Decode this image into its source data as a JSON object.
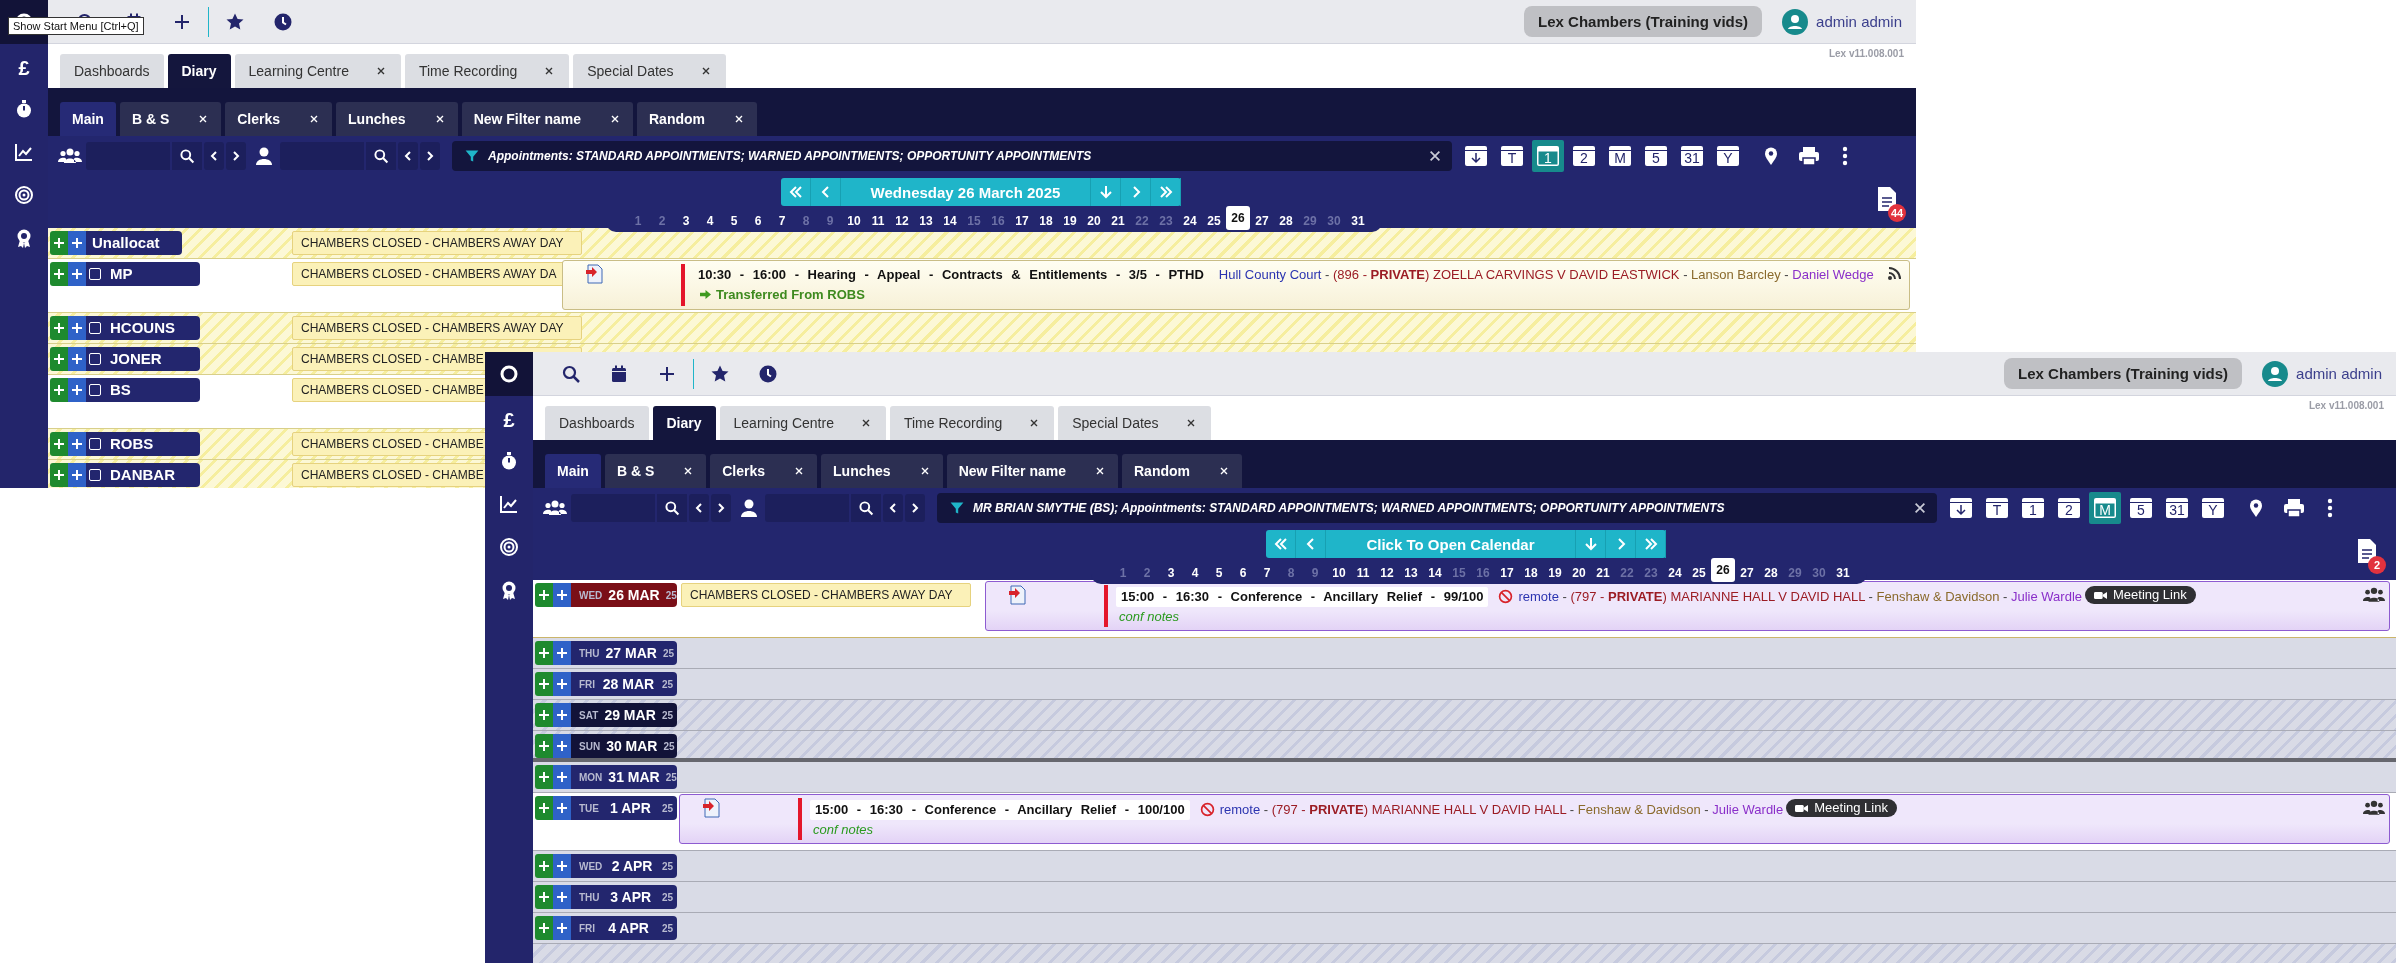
{
  "windows": [
    {
      "kind": "back",
      "tooltip": "Show Start Menu [Ctrl+Q]",
      "sidebar_currency": "£",
      "org_button": "Lex Chambers (Training vids)",
      "user": "admin admin",
      "version": "Lex v11.008.001",
      "tabs": [
        {
          "label": "Dashboards",
          "selected": false,
          "closable": false
        },
        {
          "label": "Diary",
          "selected": true,
          "closable": false
        },
        {
          "label": "Learning Centre",
          "selected": false,
          "closable": true
        },
        {
          "label": "Time Recording",
          "selected": false,
          "closable": true
        },
        {
          "label": "Special Dates",
          "selected": false,
          "closable": true
        }
      ],
      "filter_tabs": [
        {
          "label": "Main",
          "selected": true,
          "closable": false
        },
        {
          "label": "B & S",
          "selected": false,
          "closable": true
        },
        {
          "label": "Clerks",
          "selected": false,
          "closable": true
        },
        {
          "label": "Lunches",
          "selected": false,
          "closable": true
        },
        {
          "label": "New Filter name",
          "selected": false,
          "closable": true
        },
        {
          "label": "Random",
          "selected": false,
          "closable": true
        }
      ],
      "filter_text": "Appointments: STANDARD APPOINTMENTS; WARNED APPOINTMENTS; OPPORTUNITY APPOINTMENTS",
      "view_buttons": [
        {
          "kind": "arrow",
          "selected": false
        },
        {
          "kind": "letter",
          "label": "T",
          "selected": false
        },
        {
          "kind": "letter",
          "label": "1",
          "selected": true
        },
        {
          "kind": "letter",
          "label": "2",
          "selected": false
        },
        {
          "kind": "letter",
          "label": "M",
          "selected": false
        },
        {
          "kind": "letter",
          "label": "5",
          "selected": false
        },
        {
          "kind": "letter",
          "label": "31",
          "selected": false
        },
        {
          "kind": "letter",
          "label": "Y",
          "selected": false
        }
      ],
      "calendar_label": "Wednesday 26 March 2025",
      "document_badge": "44",
      "days": [
        {
          "label": "1",
          "weekend": true,
          "selected": false
        },
        {
          "label": "2",
          "weekend": true,
          "selected": false
        },
        {
          "label": "3",
          "weekend": false,
          "selected": false
        },
        {
          "label": "4",
          "weekend": false,
          "selected": false
        },
        {
          "label": "5",
          "weekend": false,
          "selected": false
        },
        {
          "label": "6",
          "weekend": false,
          "selected": false
        },
        {
          "label": "7",
          "weekend": false,
          "selected": false
        },
        {
          "label": "8",
          "weekend": true,
          "selected": false
        },
        {
          "label": "9",
          "weekend": true,
          "selected": false
        },
        {
          "label": "10",
          "weekend": false,
          "selected": false
        },
        {
          "label": "11",
          "weekend": false,
          "selected": false
        },
        {
          "label": "12",
          "weekend": false,
          "selected": false
        },
        {
          "label": "13",
          "weekend": false,
          "selected": false
        },
        {
          "label": "14",
          "weekend": false,
          "selected": false
        },
        {
          "label": "15",
          "weekend": true,
          "selected": false
        },
        {
          "label": "16",
          "weekend": true,
          "selected": false
        },
        {
          "label": "17",
          "weekend": false,
          "selected": false
        },
        {
          "label": "18",
          "weekend": false,
          "selected": false
        },
        {
          "label": "19",
          "weekend": false,
          "selected": false
        },
        {
          "label": "20",
          "weekend": false,
          "selected": false
        },
        {
          "label": "21",
          "weekend": false,
          "selected": false
        },
        {
          "label": "22",
          "weekend": true,
          "selected": false
        },
        {
          "label": "23",
          "weekend": true,
          "selected": false
        },
        {
          "label": "24",
          "weekend": false,
          "selected": false
        },
        {
          "label": "25",
          "weekend": false,
          "selected": false
        },
        {
          "label": "26",
          "weekend": false,
          "selected": true
        },
        {
          "label": "27",
          "weekend": false,
          "selected": false
        },
        {
          "label": "28",
          "weekend": false,
          "selected": false
        },
        {
          "label": "29",
          "weekend": true,
          "selected": false
        },
        {
          "label": "30",
          "weekend": true,
          "selected": false
        },
        {
          "label": "31",
          "weekend": false,
          "selected": false
        }
      ],
      "rows": [
        {
          "kind": "staff",
          "name": "Unallocat",
          "hatched": true,
          "note": "CHAMBERS CLOSED - CHAMBERS AWAY DAY"
        },
        {
          "kind": "staff",
          "name": "MP",
          "checked": false,
          "hatched": false,
          "note": "CHAMBERS CLOSED - CHAMBERS AWAY DA",
          "appointment": {
            "kind": "hearing",
            "restricted": false,
            "time_text": "10:30 - 16:00 - Hearing - Appeal - Contracts & Entitlements - 3/5 - PTHD",
            "details": [
              {
                "kind": "location",
                "text": "Hull County Court"
              },
              {
                "kind": "sep",
                "text": " - "
              },
              {
                "kind": "case",
                "text": "(896 - **PRIVATE**) ZOELLA CARVINGS V DAVID EASTWICK"
              },
              {
                "kind": "sep",
                "text": " - "
              },
              {
                "kind": "solicitor",
                "text": "Lanson Barcley"
              },
              {
                "kind": "sep",
                "text": " - "
              },
              {
                "kind": "clerk",
                "text": "Daniel Wedge"
              }
            ],
            "transfer_note": "Transferred From ROBS",
            "indicator": {
              "kind": "rss"
            }
          }
        },
        {
          "kind": "staff",
          "name": "HCOUNS",
          "checked": false,
          "hatched": true,
          "note": "CHAMBERS CLOSED - CHAMBERS AWAY DAY"
        },
        {
          "kind": "staff",
          "name": "JONER",
          "checked": false,
          "hatched": true,
          "note": "CHAMBERS CLOSED - CHAMBE"
        },
        {
          "kind": "staff",
          "name": "BS",
          "checked": false,
          "hatched": false,
          "note": "CHAMBERS CLOSED - CHAMBE"
        },
        {
          "kind": "staff",
          "name": "ROBS",
          "checked": false,
          "hatched": true,
          "note": "CHAMBERS CLOSED - CHAMBE"
        },
        {
          "kind": "staff",
          "name": "DANBAR",
          "checked": false,
          "hatched": true,
          "note": "CHAMBERS CLOSED - CHAMBE"
        }
      ]
    },
    {
      "kind": "front",
      "sidebar_currency": "£",
      "org_button": "Lex Chambers (Training vids)",
      "user": "admin admin",
      "version": "Lex v11.008.001",
      "tabs": [
        {
          "label": "Dashboards",
          "selected": false,
          "closable": false
        },
        {
          "label": "Diary",
          "selected": true,
          "closable": false
        },
        {
          "label": "Learning Centre",
          "selected": false,
          "closable": true
        },
        {
          "label": "Time Recording",
          "selected": false,
          "closable": true
        },
        {
          "label": "Special Dates",
          "selected": false,
          "closable": true
        }
      ],
      "filter_tabs": [
        {
          "label": "Main",
          "selected": true,
          "closable": false
        },
        {
          "label": "B & S",
          "selected": false,
          "closable": true
        },
        {
          "label": "Clerks",
          "selected": false,
          "closable": true
        },
        {
          "label": "Lunches",
          "selected": false,
          "closable": true
        },
        {
          "label": "New Filter name",
          "selected": false,
          "closable": true
        },
        {
          "label": "Random",
          "selected": false,
          "closable": true
        }
      ],
      "filter_text": "MR BRIAN SMYTHE (BS); Appointments: STANDARD APPOINTMENTS; WARNED APPOINTMENTS; OPPORTUNITY APPOINTMENTS",
      "view_buttons": [
        {
          "kind": "arrow",
          "selected": false
        },
        {
          "kind": "letter",
          "label": "T",
          "selected": false
        },
        {
          "kind": "letter",
          "label": "1",
          "selected": false
        },
        {
          "kind": "letter",
          "label": "2",
          "selected": false
        },
        {
          "kind": "letter",
          "label": "M",
          "selected": true
        },
        {
          "kind": "letter",
          "label": "5",
          "selected": false
        },
        {
          "kind": "letter",
          "label": "31",
          "selected": false
        },
        {
          "kind": "letter",
          "label": "Y",
          "selected": false
        }
      ],
      "calendar_label": "Click To Open Calendar",
      "document_badge": "2",
      "days": [
        {
          "label": "1",
          "weekend": true,
          "selected": false
        },
        {
          "label": "2",
          "weekend": true,
          "selected": false
        },
        {
          "label": "3",
          "weekend": false,
          "selected": false
        },
        {
          "label": "4",
          "weekend": false,
          "selected": false
        },
        {
          "label": "5",
          "weekend": false,
          "selected": false
        },
        {
          "label": "6",
          "weekend": false,
          "selected": false
        },
        {
          "label": "7",
          "weekend": false,
          "selected": false
        },
        {
          "label": "8",
          "weekend": true,
          "selected": false
        },
        {
          "label": "9",
          "weekend": true,
          "selected": false
        },
        {
          "label": "10",
          "weekend": false,
          "selected": false
        },
        {
          "label": "11",
          "weekend": false,
          "selected": false
        },
        {
          "label": "12",
          "weekend": false,
          "selected": false
        },
        {
          "label": "13",
          "weekend": false,
          "selected": false
        },
        {
          "label": "14",
          "weekend": false,
          "selected": false
        },
        {
          "label": "15",
          "weekend": true,
          "selected": false
        },
        {
          "label": "16",
          "weekend": true,
          "selected": false
        },
        {
          "label": "17",
          "weekend": false,
          "selected": false
        },
        {
          "label": "18",
          "weekend": false,
          "selected": false
        },
        {
          "label": "19",
          "weekend": false,
          "selected": false
        },
        {
          "label": "20",
          "weekend": false,
          "selected": false
        },
        {
          "label": "21",
          "weekend": false,
          "selected": false
        },
        {
          "label": "22",
          "weekend": true,
          "selected": false
        },
        {
          "label": "23",
          "weekend": true,
          "selected": false
        },
        {
          "label": "24",
          "weekend": false,
          "selected": false
        },
        {
          "label": "25",
          "weekend": false,
          "selected": false
        },
        {
          "label": "26",
          "weekend": false,
          "selected": true
        },
        {
          "label": "27",
          "weekend": false,
          "selected": false
        },
        {
          "label": "28",
          "weekend": false,
          "selected": false
        },
        {
          "label": "29",
          "weekend": true,
          "selected": false
        },
        {
          "label": "30",
          "weekend": true,
          "selected": false
        },
        {
          "label": "31",
          "weekend": false,
          "selected": false
        }
      ],
      "rows": [
        {
          "kind": "date",
          "weekday": "WED",
          "date": "26 MAR",
          "year": "25",
          "today": true,
          "hatched": false,
          "week_break_after": false,
          "note": "CHAMBERS CLOSED - CHAMBERS AWAY DAY",
          "appointment": {
            "kind": "conference",
            "restricted": true,
            "time_text": "15:00 - 16:30 - Conference - Ancillary Relief - 99/100",
            "details": [
              {
                "kind": "location",
                "text": "remote"
              },
              {
                "kind": "sep",
                "text": " - "
              },
              {
                "kind": "case",
                "text": "(797 - **PRIVATE**) MARIANNE HALL V DAVID HALL"
              },
              {
                "kind": "sep",
                "text": " - "
              },
              {
                "kind": "solicitor",
                "text": "Fenshaw & Davidson"
              },
              {
                "kind": "sep",
                "text": " - "
              },
              {
                "kind": "clerk",
                "text": "Julie Wardle"
              }
            ],
            "meeting_link": "Meeting Link",
            "notes": "conf notes",
            "indicator": {
              "kind": "group"
            }
          }
        },
        {
          "kind": "date",
          "weekday": "THU",
          "date": "27 MAR",
          "year": "25",
          "today": false,
          "hatched": false,
          "week_break_after": false
        },
        {
          "kind": "date",
          "weekday": "FRI",
          "date": "28 MAR",
          "year": "25",
          "today": false,
          "hatched": false,
          "week_break_after": false
        },
        {
          "kind": "date",
          "weekday": "SAT",
          "date": "29 MAR",
          "year": "25",
          "today": false,
          "hatched": true,
          "week_break_after": false
        },
        {
          "kind": "date",
          "weekday": "SUN",
          "date": "30 MAR",
          "year": "25",
          "today": false,
          "hatched": true,
          "week_break_after": true
        },
        {
          "kind": "date",
          "weekday": "MON",
          "date": "31 MAR",
          "year": "25",
          "today": false,
          "hatched": false,
          "week_break_after": false
        },
        {
          "kind": "date",
          "weekday": "TUE",
          "date": "1 APR",
          "year": "25",
          "today": false,
          "hatched": false,
          "week_break_after": false,
          "appointment": {
            "kind": "conference",
            "restricted": true,
            "time_text": "15:00 - 16:30 - Conference - Ancillary Relief - 100/100",
            "details": [
              {
                "kind": "location",
                "text": "remote"
              },
              {
                "kind": "sep",
                "text": " - "
              },
              {
                "kind": "case",
                "text": "(797 - **PRIVATE**) MARIANNE HALL V DAVID HALL"
              },
              {
                "kind": "sep",
                "text": " - "
              },
              {
                "kind": "solicitor",
                "text": "Fenshaw & Davidson"
              },
              {
                "kind": "sep",
                "text": " - "
              },
              {
                "kind": "clerk",
                "text": "Julie Wardle"
              }
            ],
            "meeting_link": "Meeting Link",
            "notes": "conf notes",
            "indicator": {
              "kind": "group"
            }
          }
        },
        {
          "kind": "date",
          "weekday": "WED",
          "date": "2 APR",
          "year": "25",
          "today": false,
          "hatched": false,
          "week_break_after": false
        },
        {
          "kind": "date",
          "weekday": "THU",
          "date": "3 APR",
          "year": "25",
          "today": false,
          "hatched": false,
          "week_break_after": false
        },
        {
          "kind": "date",
          "weekday": "FRI",
          "date": "4 APR",
          "year": "25",
          "today": false,
          "hatched": false,
          "week_break_after": false
        }
      ]
    }
  ]
}
